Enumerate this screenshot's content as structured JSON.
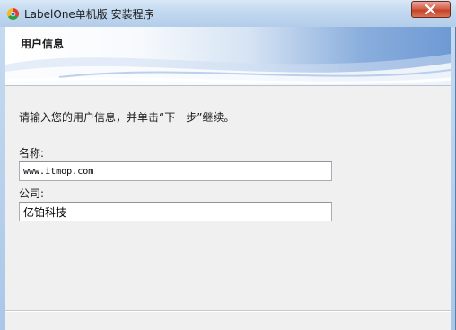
{
  "window": {
    "title": "LabelOne单机版 安装程序",
    "close_symbol": "✕"
  },
  "banner": {
    "title": "用户信息"
  },
  "instruction": "请输入您的用户信息，并单击“下一步”继续。",
  "form": {
    "name_label": "名称:",
    "name_value": "www.itmop.com",
    "company_label": "公司:",
    "company_value": "亿铂科技"
  },
  "icons": {
    "app": "labelone-app-icon",
    "close": "close-icon"
  },
  "colors": {
    "titlebar": "#c2d8ef",
    "close_button": "#c44326",
    "client_background": "#f0f0f0",
    "banner_accent": "#6e9ad4"
  }
}
